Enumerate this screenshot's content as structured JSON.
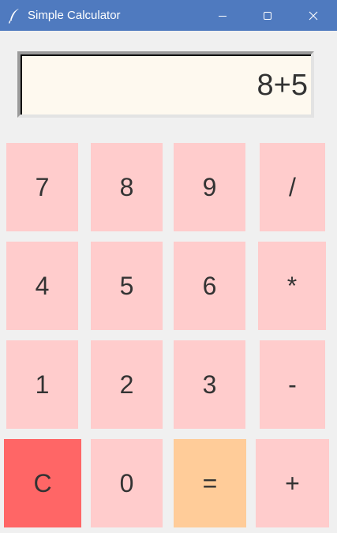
{
  "window": {
    "title": "Simple Calculator",
    "app_icon": "feather-icon",
    "controls": [
      "minimize-icon",
      "maximize-icon",
      "close-icon"
    ],
    "titlebar_color": "#4f7abf"
  },
  "display": {
    "value": "8+5",
    "background": "#fef9ef"
  },
  "keypad": {
    "rows": [
      [
        "7",
        "8",
        "9",
        "/"
      ],
      [
        "4",
        "5",
        "6",
        "*"
      ],
      [
        "1",
        "2",
        "3",
        "-"
      ],
      [
        "C",
        "0",
        "=",
        "+"
      ]
    ],
    "colors": {
      "default": "#ffcccc",
      "clear": "#ff6666",
      "equals": "#ffcc99"
    }
  }
}
